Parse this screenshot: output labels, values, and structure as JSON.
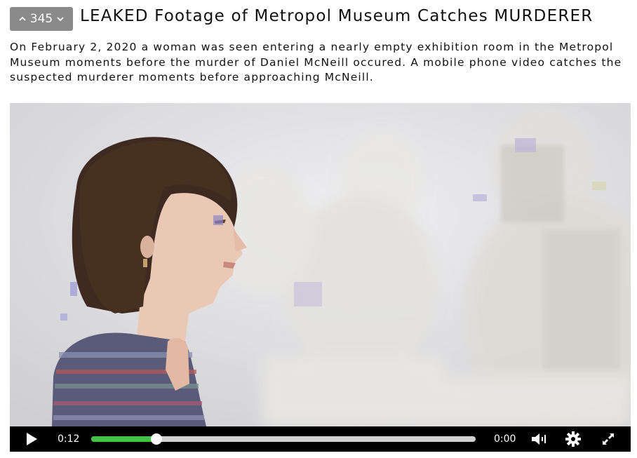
{
  "post": {
    "vote_count": "345",
    "title": "LEAKED Footage of Metropol Museum Catches MURDERER",
    "description": "On February 2, 2020 a woman was seen entering a nearly empty exhibition room in the Metropol Museum moments before the murder of Daniel McNeill occured. A mobile phone video catches the suspected murderer moments before approaching McNeill."
  },
  "icons": {
    "upvote": "chevron-up-icon",
    "downvote": "chevron-down-icon",
    "play": "play-icon",
    "volume": "volume-icon",
    "settings": "gear-icon",
    "fullscreen": "fullscreen-icon"
  },
  "video": {
    "current_time": "0:12",
    "duration": "0:00",
    "progress_fraction": 0.17,
    "progress_color": "#45c146"
  }
}
